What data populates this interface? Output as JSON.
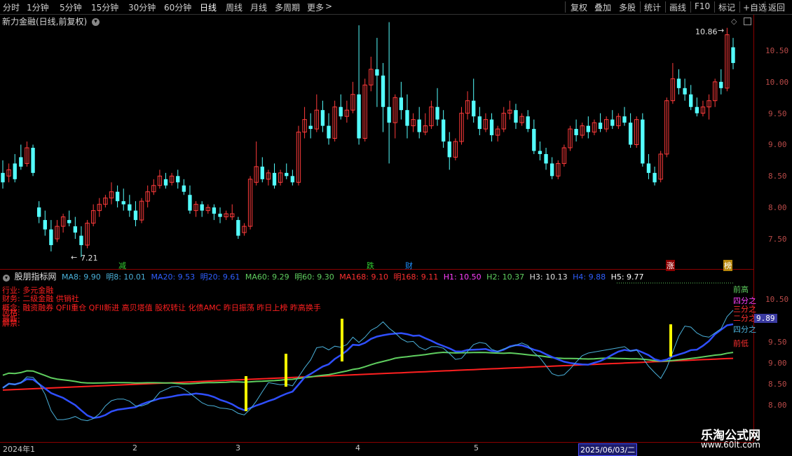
{
  "toolbar": {
    "timeframes": [
      "分时",
      "1分钟",
      "5分钟",
      "15分钟",
      "30分钟",
      "60分钟",
      "日线",
      "周线",
      "月线",
      "多周期",
      "更多"
    ],
    "active_timeframe": "日线",
    "more_arrow": ">",
    "right_buttons": [
      "复权",
      "叠加",
      "多股",
      "统计",
      "画线",
      "F10",
      "标记",
      "+自选",
      "返回"
    ]
  },
  "chart": {
    "title": "新力金融(日线,前复权)",
    "high_label": "10.86",
    "low_label": "7.21",
    "price_ticks": [
      "10.50",
      "10.00",
      "9.50",
      "9.00",
      "8.50",
      "8.00",
      "7.50"
    ],
    "markers": [
      {
        "text": "减",
        "color": "#32cd32"
      },
      {
        "text": "跌",
        "color": "#32cd32"
      },
      {
        "text": "财",
        "color": "#1e90ff"
      },
      {
        "text": "涨",
        "color": "#ff3030"
      },
      {
        "text": "榜",
        "color": "#ffa500"
      }
    ]
  },
  "indicator": {
    "name": "股朋指标网",
    "values": [
      {
        "text": "MA8: 9.90",
        "color": "#4ab0d9"
      },
      {
        "text": "明8: 10.01",
        "color": "#4ab0d9"
      },
      {
        "text": "MA20: 9.53",
        "color": "#2f5fff"
      },
      {
        "text": "明20: 9.61",
        "color": "#2f5fff"
      },
      {
        "text": "MA60: 9.29",
        "color": "#5fce5f"
      },
      {
        "text": "明60: 9.30",
        "color": "#5fce5f"
      },
      {
        "text": "MA168: 9.10",
        "color": "#ff3030"
      },
      {
        "text": "明168: 9.11",
        "color": "#ff3030"
      },
      {
        "text": "H1: 10.50",
        "color": "#ff40ff"
      },
      {
        "text": "H2: 10.37",
        "color": "#5fce5f"
      },
      {
        "text": "H3: 10.13",
        "color": "#e0e0e0"
      },
      {
        "text": "H4: 9.88",
        "color": "#2f5fff"
      },
      {
        "text": "H5: 9.77",
        "color": "#ffffff"
      }
    ],
    "info_lines": [
      "行业: 多元金融",
      "财务: 二级金融 供销社",
      "概念: 融资融券 QFII重仓 QFII新进 高贝塔值 股权转让 化债AMC 昨日振荡 昨日上榜 昨高换手",
      "风格:",
      "最新:",
      "解禁:"
    ],
    "right_labels": [
      {
        "text": "前高",
        "color": "#5fce5f"
      },
      {
        "text": "四分之",
        "color": "#ff40ff"
      },
      {
        "text": "三分之",
        "color": "#ff3030"
      },
      {
        "text": "二分之",
        "color": "#ff3030"
      },
      {
        "text": "四分之",
        "color": "#4ab0d9"
      },
      {
        "text": "前低",
        "color": "#ff3030"
      }
    ],
    "axis_ticks": [
      "10.50",
      "9.50",
      "9.00",
      "8.50",
      "8.00"
    ],
    "current_value": "9.89"
  },
  "timeline": {
    "labels": [
      "2024年1",
      "2",
      "3",
      "4",
      "5"
    ],
    "cursor_date": "2025/06/03/二"
  },
  "watermark": {
    "site": "乐淘公式网",
    "url": "www.60lt.com"
  },
  "chart_data": {
    "type": "candlestick",
    "y_ticks_main": [
      7.5,
      8.0,
      8.5,
      9.0,
      9.5,
      10.0,
      10.5
    ],
    "high_marker": 10.86,
    "low_marker": 7.21,
    "candles": [
      [
        8.55,
        8.75,
        8.4,
        8.3
      ],
      [
        8.5,
        8.7,
        8.6,
        8.4
      ],
      [
        8.7,
        8.85,
        8.45,
        8.4
      ],
      [
        8.8,
        9.0,
        8.65,
        8.6
      ],
      [
        8.7,
        9.05,
        8.95,
        8.65
      ],
      [
        8.95,
        9.0,
        8.55,
        8.5
      ],
      [
        8.0,
        8.1,
        7.85,
        7.75
      ],
      [
        7.8,
        7.95,
        7.65,
        7.55
      ],
      [
        7.65,
        7.8,
        7.4,
        7.3
      ],
      [
        7.5,
        7.8,
        7.7,
        7.45
      ],
      [
        7.7,
        7.9,
        7.85,
        7.6
      ],
      [
        7.8,
        7.95,
        7.75,
        7.7
      ],
      [
        7.7,
        7.85,
        7.6,
        7.5
      ],
      [
        7.55,
        7.7,
        7.4,
        7.21
      ],
      [
        7.4,
        7.8,
        7.75,
        7.35
      ],
      [
        7.75,
        8.05,
        7.95,
        7.7
      ],
      [
        7.95,
        8.15,
        8.05,
        7.85
      ],
      [
        8.05,
        8.2,
        8.15,
        8.0
      ],
      [
        8.15,
        8.4,
        8.25,
        8.05
      ],
      [
        8.25,
        8.35,
        8.1,
        8.0
      ],
      [
        8.1,
        8.3,
        8.05,
        7.95
      ],
      [
        8.05,
        8.2,
        7.95,
        7.85
      ],
      [
        7.95,
        8.1,
        7.8,
        7.7
      ],
      [
        7.8,
        8.15,
        8.1,
        7.75
      ],
      [
        8.1,
        8.35,
        8.25,
        8.0
      ],
      [
        8.25,
        8.45,
        8.35,
        8.2
      ],
      [
        8.35,
        8.6,
        8.5,
        8.3
      ],
      [
        8.45,
        8.55,
        8.35,
        8.3
      ],
      [
        8.4,
        8.55,
        8.5,
        8.35
      ],
      [
        8.5,
        8.6,
        8.4,
        8.3
      ],
      [
        8.35,
        8.45,
        8.25,
        8.2
      ],
      [
        8.2,
        8.35,
        7.95,
        7.9
      ],
      [
        7.95,
        8.1,
        8.05,
        7.85
      ],
      [
        8.05,
        8.1,
        7.95,
        7.85
      ],
      [
        7.95,
        8.05,
        8.0,
        7.9
      ],
      [
        8.0,
        8.05,
        7.9,
        7.8
      ],
      [
        7.9,
        8.0,
        7.85,
        7.75
      ],
      [
        7.85,
        7.95,
        7.9,
        7.8
      ],
      [
        7.85,
        8.05,
        7.9,
        7.8
      ],
      [
        7.8,
        7.85,
        7.55,
        7.5
      ],
      [
        7.6,
        7.75,
        7.7,
        7.55
      ],
      [
        7.7,
        8.5,
        8.45,
        7.65
      ],
      [
        8.4,
        9.05,
        8.65,
        8.35
      ],
      [
        8.65,
        8.8,
        8.45,
        8.4
      ],
      [
        8.45,
        8.6,
        8.55,
        8.35
      ],
      [
        8.55,
        8.7,
        8.35,
        8.3
      ],
      [
        8.4,
        8.6,
        8.55,
        8.35
      ],
      [
        8.55,
        8.7,
        8.5,
        8.45
      ],
      [
        8.5,
        8.6,
        8.4,
        8.35
      ],
      [
        8.4,
        9.3,
        9.2,
        8.35
      ],
      [
        9.2,
        9.6,
        9.4,
        9.1
      ],
      [
        9.3,
        9.5,
        9.25,
        9.1
      ],
      [
        9.25,
        9.8,
        9.55,
        9.2
      ],
      [
        9.55,
        9.7,
        9.3,
        9.2
      ],
      [
        9.3,
        9.5,
        9.1,
        9.0
      ],
      [
        9.1,
        9.7,
        9.6,
        9.05
      ],
      [
        9.6,
        9.8,
        9.45,
        9.4
      ],
      [
        9.45,
        9.7,
        9.55,
        9.35
      ],
      [
        9.55,
        10.0,
        9.8,
        9.5
      ],
      [
        9.8,
        10.9,
        9.1,
        9.0
      ],
      [
        9.1,
        10.05,
        9.95,
        9.05
      ],
      [
        9.95,
        10.4,
        10.2,
        9.85
      ],
      [
        10.2,
        10.7,
        10.1,
        9.6
      ],
      [
        10.1,
        10.3,
        9.6,
        9.2
      ],
      [
        9.6,
        10.95,
        9.35,
        8.7
      ],
      [
        9.35,
        9.8,
        9.75,
        9.1
      ],
      [
        9.75,
        10.0,
        9.55,
        9.4
      ],
      [
        9.55,
        9.8,
        9.3,
        9.1
      ],
      [
        9.3,
        9.5,
        9.4,
        9.2
      ],
      [
        9.4,
        9.6,
        9.2,
        9.1
      ],
      [
        9.2,
        9.5,
        9.3,
        9.15
      ],
      [
        9.3,
        9.7,
        9.6,
        9.25
      ],
      [
        9.6,
        9.9,
        9.4,
        9.3
      ],
      [
        9.4,
        9.55,
        9.05,
        8.95
      ],
      [
        9.05,
        9.2,
        8.8,
        8.6
      ],
      [
        8.8,
        9.1,
        9.05,
        8.75
      ],
      [
        9.05,
        9.6,
        9.5,
        9.0
      ],
      [
        9.5,
        9.85,
        9.7,
        9.4
      ],
      [
        9.7,
        10.05,
        9.45,
        9.35
      ],
      [
        9.45,
        9.6,
        9.25,
        9.15
      ],
      [
        9.25,
        9.5,
        9.4,
        9.2
      ],
      [
        9.4,
        9.5,
        9.15,
        9.05
      ],
      [
        9.15,
        9.3,
        9.25,
        9.05
      ],
      [
        9.25,
        9.6,
        9.5,
        9.2
      ],
      [
        9.5,
        9.7,
        9.55,
        9.4
      ],
      [
        9.55,
        9.65,
        9.35,
        9.25
      ],
      [
        9.35,
        9.5,
        9.45,
        9.3
      ],
      [
        9.45,
        9.55,
        9.25,
        9.2
      ],
      [
        9.25,
        9.4,
        8.9,
        8.85
      ],
      [
        8.9,
        9.05,
        8.85,
        8.75
      ],
      [
        8.85,
        8.95,
        8.7,
        8.6
      ],
      [
        8.7,
        8.8,
        8.5,
        8.45
      ],
      [
        8.5,
        8.75,
        8.7,
        8.45
      ],
      [
        8.7,
        9.0,
        8.95,
        8.65
      ],
      [
        8.95,
        9.3,
        9.25,
        8.9
      ],
      [
        9.25,
        9.4,
        9.15,
        9.05
      ],
      [
        9.15,
        9.35,
        9.3,
        9.1
      ],
      [
        9.3,
        9.45,
        9.2,
        9.1
      ],
      [
        9.2,
        9.4,
        9.35,
        9.15
      ],
      [
        9.35,
        9.5,
        9.25,
        9.2
      ],
      [
        9.25,
        9.45,
        9.4,
        9.2
      ],
      [
        9.4,
        9.55,
        9.3,
        9.25
      ],
      [
        9.3,
        9.5,
        9.45,
        9.25
      ],
      [
        9.45,
        9.6,
        9.35,
        9.3
      ],
      [
        9.35,
        9.5,
        9.0,
        8.95
      ],
      [
        9.0,
        9.45,
        9.4,
        8.95
      ],
      [
        9.4,
        9.5,
        8.7,
        8.65
      ],
      [
        8.7,
        8.85,
        8.55,
        8.45
      ],
      [
        8.55,
        8.65,
        8.4,
        8.35
      ],
      [
        8.45,
        8.9,
        8.85,
        8.4
      ],
      [
        8.85,
        9.75,
        9.7,
        8.8
      ],
      [
        9.7,
        10.3,
        10.05,
        9.65
      ],
      [
        10.05,
        10.2,
        9.9,
        9.8
      ],
      [
        9.9,
        10.05,
        9.8,
        9.7
      ],
      [
        9.8,
        9.95,
        9.6,
        9.55
      ],
      [
        9.6,
        9.75,
        9.5,
        9.45
      ],
      [
        9.5,
        9.7,
        9.6,
        9.45
      ],
      [
        9.6,
        9.8,
        9.7,
        9.4
      ],
      [
        9.7,
        10.05,
        10.0,
        9.6
      ],
      [
        10.0,
        10.2,
        9.9,
        9.8
      ],
      [
        9.9,
        10.86,
        10.75,
        9.85
      ],
      [
        10.55,
        10.7,
        10.3,
        10.2
      ]
    ],
    "sub_y_ticks": [
      8.0,
      8.5,
      9.0,
      9.5,
      10.5
    ]
  }
}
